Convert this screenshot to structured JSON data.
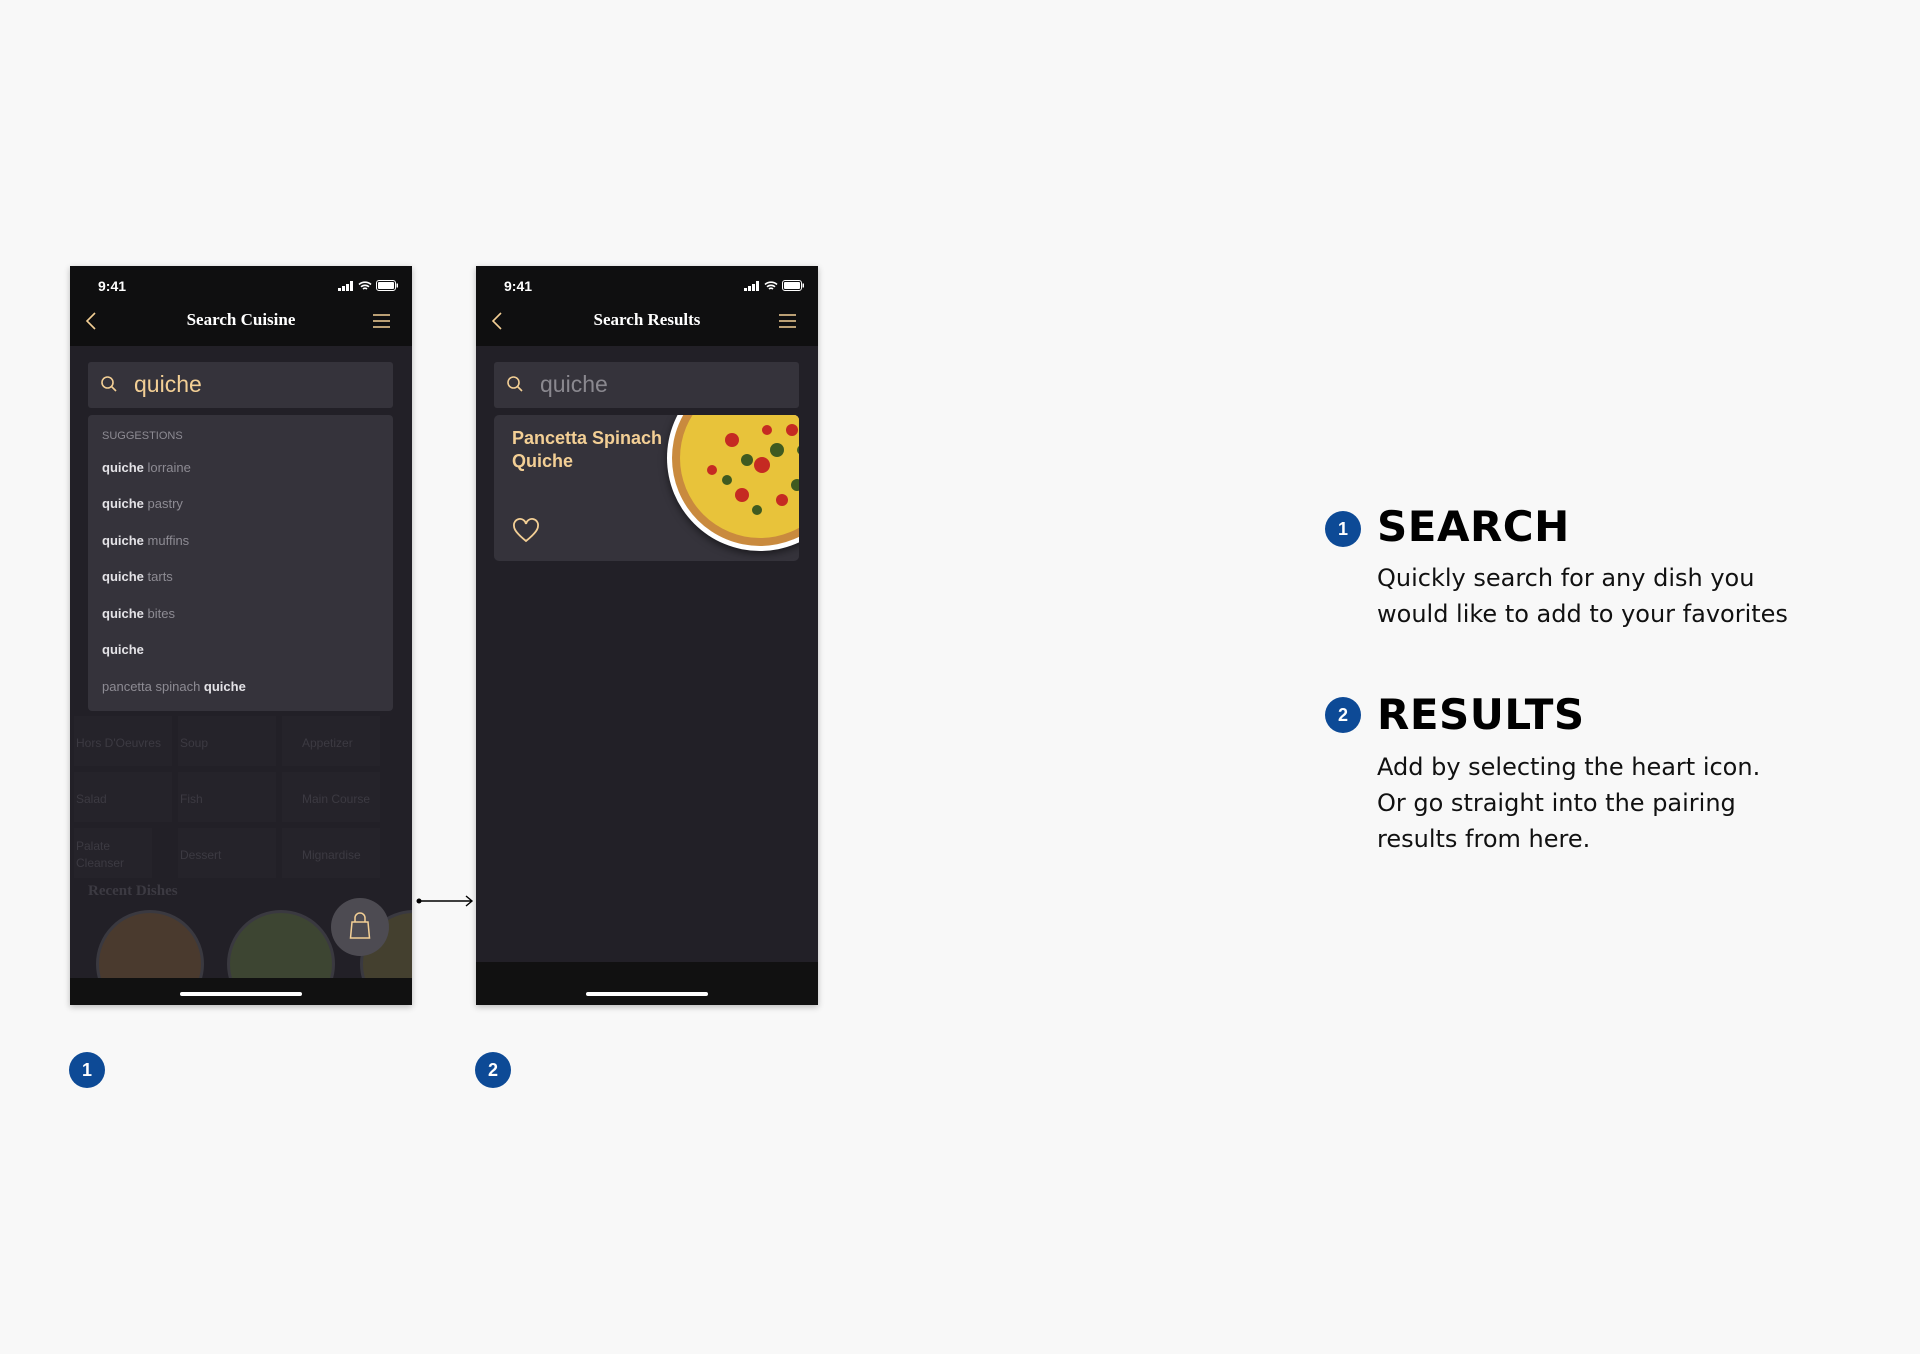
{
  "phone1": {
    "time": "9:41",
    "title": "Search Cuisine",
    "search_value": "quiche",
    "suggestions_label": "SUGGESTIONS",
    "suggestions": [
      {
        "bold": "quiche",
        "rest": " lorraine",
        "pre": ""
      },
      {
        "bold": "quiche",
        "rest": " pastry",
        "pre": ""
      },
      {
        "bold": "quiche",
        "rest": " muffins",
        "pre": ""
      },
      {
        "bold": "quiche",
        "rest": " tarts",
        "pre": ""
      },
      {
        "bold": "quiche",
        "rest": " bites",
        "pre": ""
      },
      {
        "bold": "quiche",
        "rest": "",
        "pre": ""
      },
      {
        "bold": "quiche",
        "rest": "",
        "pre": "pancetta spinach "
      }
    ],
    "categories": [
      "Hors D'Oeuvres",
      "Soup",
      "Appetizer",
      "Salad",
      "Fish",
      "Main Course",
      "Palate Cleanser",
      "Dessert",
      "Mignardise"
    ],
    "recent_label": "Recent Dishes"
  },
  "phone2": {
    "time": "9:41",
    "title": "Search Results",
    "search_value": "quiche",
    "result": {
      "title": "Pancetta Spinach Quiche"
    }
  },
  "steps": [
    {
      "num": "1",
      "heading": "SEARCH",
      "lines": [
        "Quickly search for any dish you",
        "would like to add to your favorites"
      ]
    },
    {
      "num": "2",
      "heading": "RESULTS",
      "lines": [
        "Add by selecting the heart icon.",
        "Or go straight into the pairing",
        "results from here."
      ]
    }
  ],
  "colors": {
    "accent": "#f3cf95",
    "badge": "#0d4a96",
    "screen_bg": "#222027",
    "card_bg": "#35333b"
  }
}
